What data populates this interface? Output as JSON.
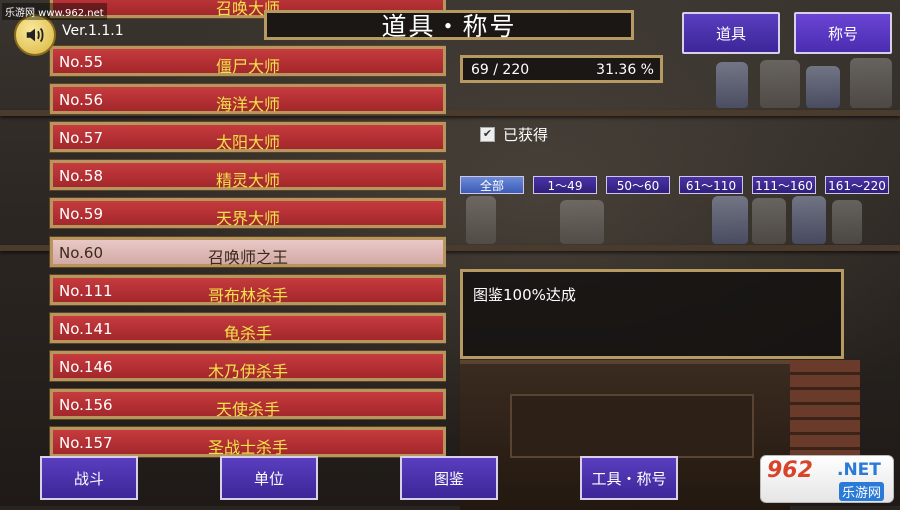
{
  "watermark": "乐游网 www.962.net",
  "version": "Ver.1.1.1",
  "title": "道具・称号",
  "partial_row_name": "召唤大师",
  "titles_list": [
    {
      "no": "No.55",
      "name": "僵尸大师",
      "selected": false
    },
    {
      "no": "No.56",
      "name": "海洋大师",
      "selected": false
    },
    {
      "no": "No.57",
      "name": "太阳大师",
      "selected": false
    },
    {
      "no": "No.58",
      "name": "精灵大师",
      "selected": false
    },
    {
      "no": "No.59",
      "name": "天界大师",
      "selected": false
    },
    {
      "no": "No.60",
      "name": "召唤师之王",
      "selected": true
    },
    {
      "no": "No.111",
      "name": "哥布林杀手",
      "selected": false
    },
    {
      "no": "No.141",
      "name": "龟杀手",
      "selected": false
    },
    {
      "no": "No.146",
      "name": "木乃伊杀手",
      "selected": false
    },
    {
      "no": "No.156",
      "name": "天使杀手",
      "selected": false
    },
    {
      "no": "No.157",
      "name": "圣战士杀手",
      "selected": false
    }
  ],
  "progress": {
    "count": "69 / 220",
    "percent": "31.36 %"
  },
  "category_buttons": {
    "items": "道具",
    "titles": "称号"
  },
  "obtained_filter": {
    "label": "已获得",
    "checked": true
  },
  "range_filters": [
    "全部",
    "1～49",
    "50～60",
    "61～110",
    "111～160",
    "161～220"
  ],
  "active_range_filter": "全部",
  "description": "图鉴100%达成",
  "bottom_nav": [
    "战斗",
    "单位",
    "图鉴",
    "工具・称号"
  ],
  "logo": {
    "number": "962",
    "net": ".NET",
    "text": "乐游网"
  },
  "colors": {
    "row_red": "#b32f33",
    "row_selected": "#e0bcb8",
    "gold_text": "#f2e24a",
    "button_purple": "#4b32ac",
    "frame_gold": "#b79a62"
  }
}
